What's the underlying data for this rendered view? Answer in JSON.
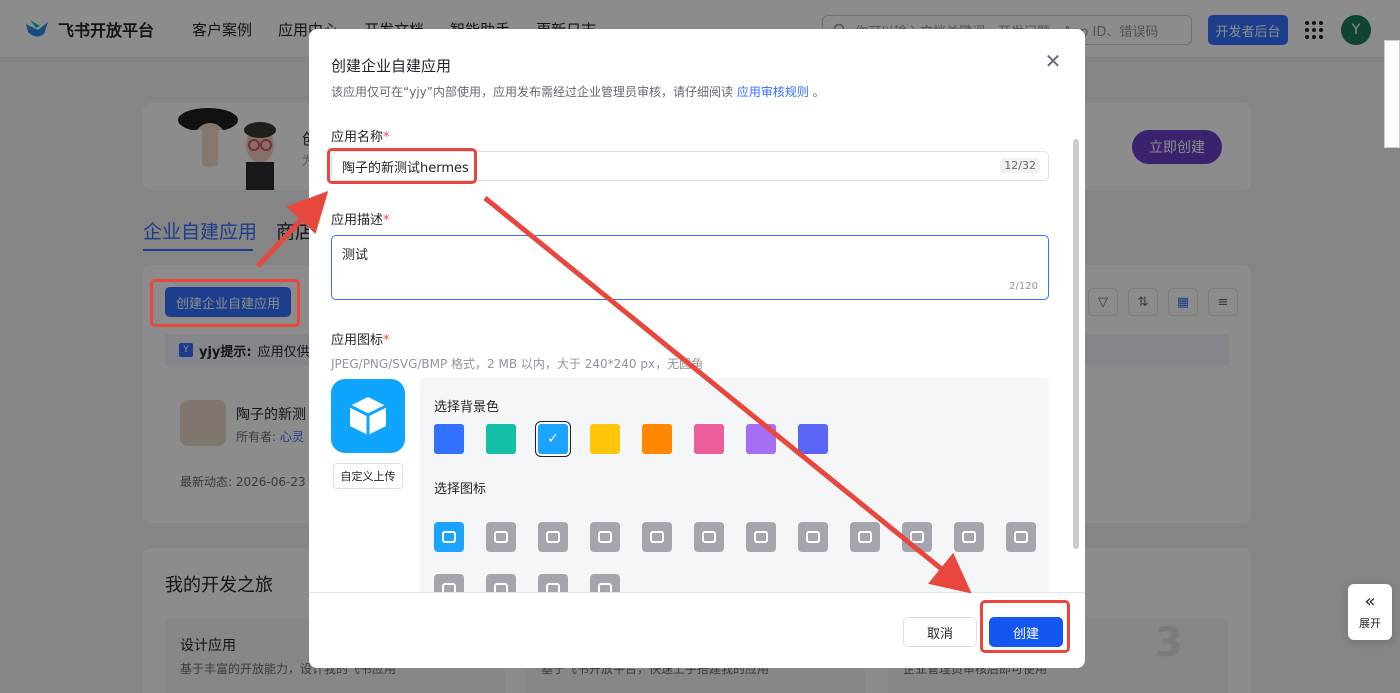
{
  "brand": {
    "name": "飞书开放平台"
  },
  "topnav": [
    "客户案例",
    "应用中心",
    "开发文档",
    "智能助手",
    "更新日志"
  ],
  "search": {
    "placeholder": "你可以输入文档关键词、开发问题、App ID、错误码"
  },
  "header": {
    "dev_console": "开发者后台",
    "avatar_letter": "Y"
  },
  "hero": {
    "title_fragment": "创",
    "subtitle_fragment": "为",
    "create_now": "立即创建"
  },
  "tabs": {
    "active": "企业自建应用",
    "second": "商店"
  },
  "panel": {
    "create_button": "创建企业自建应用",
    "hint_badge": "Y",
    "hint_bold": "yjy提示:",
    "hint_text": "应用仅供",
    "tools": [
      "▽",
      "⇅",
      "▦",
      "≡"
    ],
    "app": {
      "name": "陶子的新测",
      "owner_label": "所有者:",
      "owner_name": "心灵",
      "date": "最新动态: 2026-06-23"
    }
  },
  "journey": {
    "title": "我的开发之旅",
    "steps": [
      {
        "title": "设计应用",
        "desc": "基于丰富的开放能力，设计我的飞书应用"
      },
      {
        "desc": "基于飞书开放平台，快速上手搭建我的应用"
      },
      {
        "desc": "企业管理员审核后即可使用"
      }
    ],
    "step_num": "3"
  },
  "expand": {
    "label": "展开",
    "icon": "double-chevron-left"
  },
  "modal": {
    "title": "创建企业自建应用",
    "desc_prefix": "该应用仅可在“yjy”内部使用，应用发布需经过企业管理员审核，请仔细阅读",
    "desc_link": "应用审核规则",
    "desc_suffix": "。",
    "name_label": "应用名称",
    "name_value": "陶子的新测试hermes",
    "name_count": "12/32",
    "desc_label": "应用描述",
    "desc_value": "测试",
    "desc_count": "2/120",
    "icon_label": "应用图标",
    "icon_hint": "JPEG/PNG/SVG/BMP 格式，2 MB 以内，大于 240*240 px，无圆角",
    "upload_label": "自定义上传",
    "bg_label": "选择背景色",
    "bg_colors": [
      "#3370ff",
      "#14c0a5",
      "#1aa3ff",
      "#ffc60a",
      "#ff8800",
      "#ec5e9a",
      "#a56ef5",
      "#5b65f5"
    ],
    "selected_bg_index": 2,
    "icon_pick_label": "选择图标",
    "icon_names": [
      "cube-icon",
      "robot-icon",
      "bulb-icon",
      "chart-icon",
      "briefcase-icon",
      "bell-icon",
      "task-icon",
      "pie-icon",
      "star-icon",
      "tag-icon",
      "wrench-icon",
      "doc-icon",
      "shield-icon",
      "layout-icon",
      "people-icon",
      "code-icon"
    ],
    "cancel": "取消",
    "create": "创建"
  },
  "colors": {
    "accent": "#3370ff",
    "annotation": "#e8473d"
  }
}
